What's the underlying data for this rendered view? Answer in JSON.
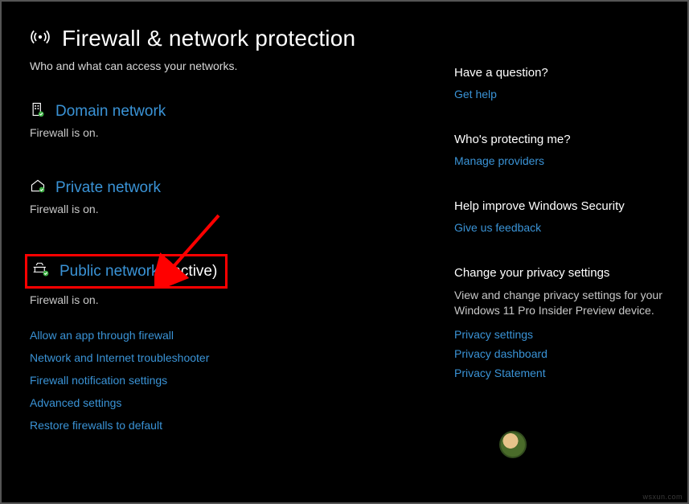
{
  "header": {
    "title": "Firewall & network protection",
    "subtitle": "Who and what can access your networks."
  },
  "networks": {
    "domain": {
      "label": "Domain network",
      "status": "Firewall is on."
    },
    "private": {
      "label": "Private network",
      "status": "Firewall is on."
    },
    "public": {
      "label": "Public network",
      "active_suffix": "(active)",
      "status": "Firewall is on."
    }
  },
  "action_links": {
    "allow_app": "Allow an app through firewall",
    "troubleshooter": "Network and Internet troubleshooter",
    "notification": "Firewall notification settings",
    "advanced": "Advanced settings",
    "restore": "Restore firewalls to default"
  },
  "sidebar": {
    "question": {
      "title": "Have a question?",
      "link": "Get help"
    },
    "protecting": {
      "title": "Who's protecting me?",
      "link": "Manage providers"
    },
    "improve": {
      "title": "Help improve Windows Security",
      "link": "Give us feedback"
    },
    "privacy": {
      "title": "Change your privacy settings",
      "body": "View and change privacy settings for your Windows 11 Pro Insider Preview device.",
      "links": {
        "settings": "Privacy settings",
        "dashboard": "Privacy dashboard",
        "statement": "Privacy Statement"
      }
    }
  },
  "footer": {
    "mark": "wsxun.com"
  }
}
